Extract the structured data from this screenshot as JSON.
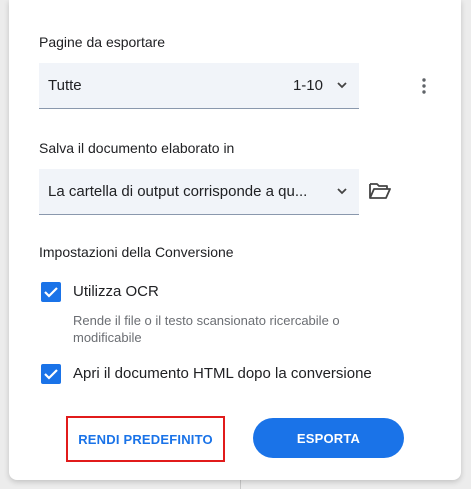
{
  "pages": {
    "label": "Pagine da esportare",
    "selected": "Tutte",
    "range": "1-10"
  },
  "save": {
    "label": "Salva il documento elaborato in",
    "selected": "La cartella di output corrisponde a qu..."
  },
  "conversion": {
    "label": "Impostazioni della Conversione",
    "ocr_label": "Utilizza OCR",
    "ocr_checked": true,
    "ocr_hint": "Rende il file o il testo scansionato ricercabile o modificabile",
    "open_html_label": "Apri il documento HTML dopo la conversione",
    "open_html_checked": true
  },
  "actions": {
    "default_label": "RENDI PREDEFINITO",
    "export_label": "ESPORTA"
  },
  "colors": {
    "accent": "#1a73e8",
    "highlight_border": "#e11b1b",
    "field_bg": "#f1f4f9"
  },
  "icons": [
    "chevron-down-icon",
    "more-vert-icon",
    "folder-open-icon",
    "checkmark-icon"
  ]
}
